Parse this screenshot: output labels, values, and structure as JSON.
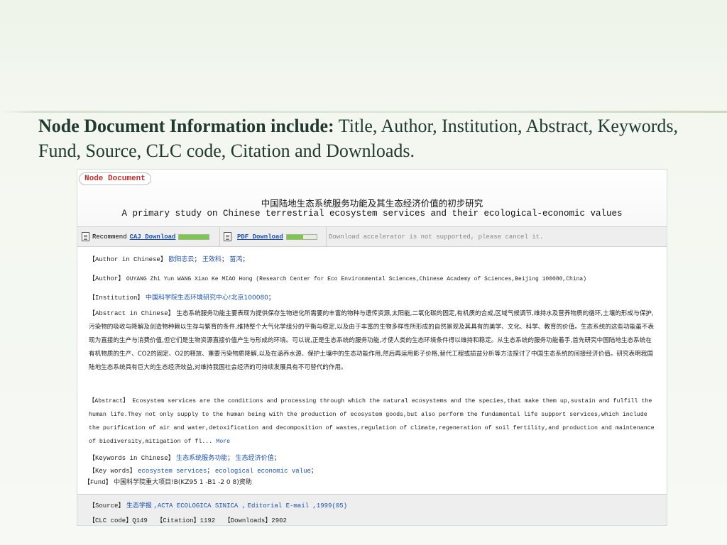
{
  "heading": {
    "bold": "Node Document Information include:",
    "rest": " Title, Author, Institution, Abstract, Keywords, Fund, Source, CLC code, Citation and Downloads."
  },
  "badge": "Node Document",
  "title_cn": "中国陆地生态系统服务功能及其生态经济价值的初步研究",
  "title_en": "A primary study on Chinese terrestrial ecosystem services and their ecological-economic values",
  "toolbar": {
    "recommend": "Recommend",
    "caj": "CAJ Download",
    "pdf": "PDF Download",
    "caj_progress": 1,
    "pdf_progress": 0.55,
    "notice": "Download accelerator is not supported, please cancel it."
  },
  "fields": {
    "author_cn_label": "【Author in Chinese】",
    "author_cn": [
      "欧阳志云",
      "王效科",
      "苗鸿"
    ],
    "author_label": "【Author】",
    "author_value": "OUYANG Zhi Yun WANG Xiao Ke MIAO Hong (Research Center for Eco Environmental Sciences,Chinese Academy of Sciences,Beijing 100080,China)",
    "institution_label": "【Institution】",
    "institution_value": "中国科学院生态环境研究中心!北京100080",
    "abstract_cn_label": "【Abstract in Chinese】",
    "abstract_cn_value": "生态系统服务功能主要表现为提供保存生物进化所需要的丰富的物种与遗传资源,太阳能,二氧化碳的固定,有机质的合成,区域气候调节,维持水及营养物质的循环,土壤的形成与保护,污染物的吸收与降解及创造物种赖以生存与繁育的条件,维持整个大气化学组分的平衡与稳定,以及由于丰富的生物多样性所形成的自然景观及其具有的美学、文化、科学、教育的价值。生态系统的这些功能虽不表现为直接的生产与消费价值,但它们是生物资源直接价值产生与形成的环境。可以说,正是生态系统的服务功能,才使人类的生态环境条件得以维持和稳定。从生态系统的服务功能着手,首先研究中国陆地生态系统在有机物质的生产、CO2的固定、O2的释放、重要污染物质降解,以及在涵养水源、保护土壤中的生态功能作用,然后再运用影子价格,替代工程或损益分析等方法探讨了中国生态系统的间接经济价值。研究表明我国陆地生态系统具有巨大的生态经济效益,对维持我国社会经济的可持续发展具有不可替代的作用。",
    "abstract_label": "【Abstract】",
    "abstract_value": "Ecosystem services are the conditions and processing through which the natural ecosystems and the species,that make them up,sustain and fulfill the human life.They not only supply to the human being with the production of ecosystem goods,but also perform the fundamental life support services,which include the purification of air and water,detoxification and decomposition of wastes,regulation of climate,regeneration of soil fertility,and production and maintenance of biodiversity,mitigation of fl...",
    "more": "More",
    "keywords_cn_label": "【Keywords in Chinese】",
    "keywords_cn": [
      "生态系统服务功能",
      "生态经济价值"
    ],
    "keywords_label": "【Key words】",
    "keywords": [
      "ecosystem services",
      "ecological economic value"
    ],
    "fund_label": "【Fund】",
    "fund_value": "中国科学院重大项目!B(KZ95 1 -B1 -2 0 8)资助"
  },
  "source": {
    "label": "【Source】",
    "journal_cn": "生态学报",
    "journal_en": ",ACTA ECOLOGICA SINICA ,",
    "editorial": "Editorial E-mail ,1999(05)",
    "clc_label": "【CLC code】",
    "clc_value": "Q149",
    "citation_label": "【Citation】",
    "citation_value": "1192",
    "downloads_label": "【Downloads】",
    "downloads_value": "2902"
  }
}
